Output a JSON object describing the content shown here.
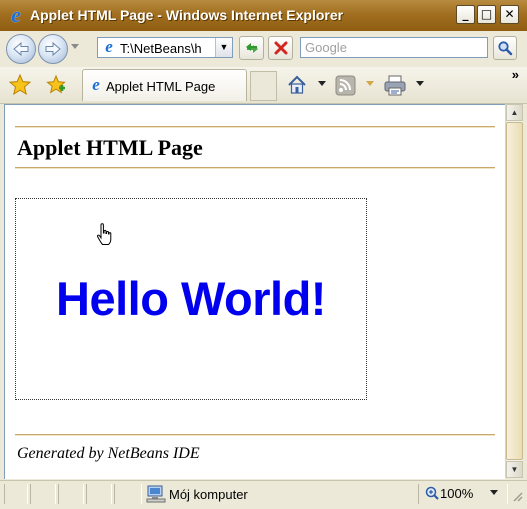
{
  "window": {
    "title": "Applet HTML Page - Windows Internet Explorer",
    "controls": {
      "minimize": "_",
      "maximize": "□",
      "close": "✕"
    }
  },
  "address_bar": {
    "url": "T:\\NetBeans\\h",
    "icon": "ie-page-icon"
  },
  "search": {
    "placeholder": "Google"
  },
  "tabs": [
    {
      "label": "Applet HTML Page"
    }
  ],
  "page": {
    "heading": "Applet HTML Page",
    "applet_text": "Hello World!",
    "applet_text_color": "#0000ee",
    "footer": "Generated by NetBeans IDE"
  },
  "status_bar": {
    "zone": "Mój komputer",
    "zoom": "100%"
  },
  "colors": {
    "titlebar": "#a26f20",
    "rule": "#c9a870",
    "address_border": "#7f9db9"
  }
}
